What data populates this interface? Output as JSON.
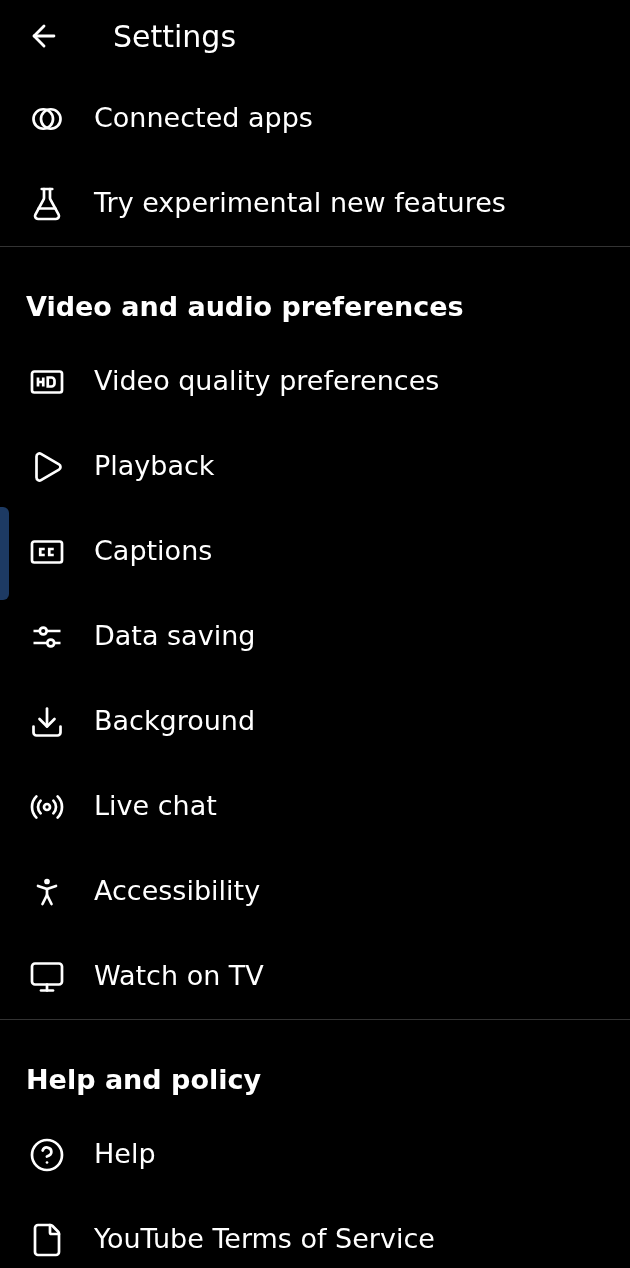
{
  "header": {
    "title": "Settings"
  },
  "top_items": [
    {
      "label": "Connected apps"
    },
    {
      "label": "Try experimental new features"
    }
  ],
  "sections": [
    {
      "title": "Video and audio preferences",
      "items": [
        {
          "label": "Video quality preferences"
        },
        {
          "label": "Playback"
        },
        {
          "label": "Captions"
        },
        {
          "label": "Data saving"
        },
        {
          "label": "Background"
        },
        {
          "label": "Live chat"
        },
        {
          "label": "Accessibility"
        },
        {
          "label": "Watch on TV"
        }
      ]
    },
    {
      "title": "Help and policy",
      "items": [
        {
          "label": "Help"
        },
        {
          "label": "YouTube Terms of Service"
        }
      ]
    }
  ]
}
